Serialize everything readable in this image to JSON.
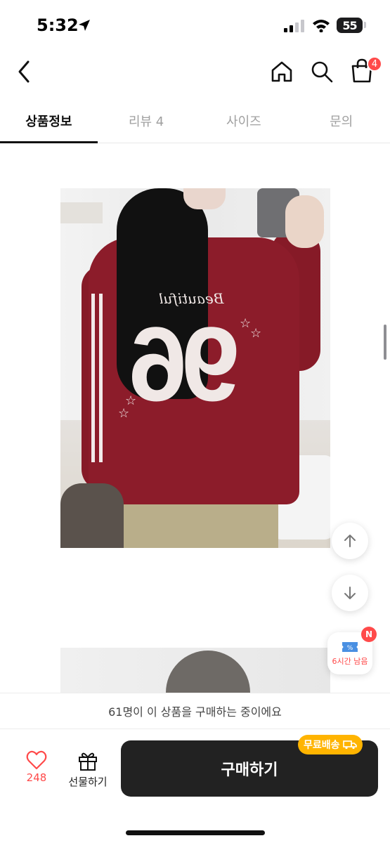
{
  "status_bar": {
    "time": "5:32",
    "battery": "55"
  },
  "header": {
    "cart_badge": "4",
    "icons": [
      "back-icon",
      "home-icon",
      "search-icon",
      "shopping-bag-icon"
    ]
  },
  "tabs": [
    {
      "label": "상품정보",
      "active": true
    },
    {
      "label": "리뷰 4",
      "active": false
    },
    {
      "label": "사이즈",
      "active": false
    },
    {
      "label": "문의",
      "active": false
    }
  ],
  "product_image": {
    "script_text": "Beautiful",
    "number": "96"
  },
  "floating": {
    "coupon_badge": "N",
    "coupon_label": "6시간 남음"
  },
  "notice": {
    "text": "61명이 이 상품을 구매하는 중이에요"
  },
  "bottom_bar": {
    "like_count": "248",
    "gift_label": "선물하기",
    "buy_label": "구매하기",
    "free_shipping_label": "무료배송"
  },
  "colors": {
    "accent_red": "#ff4a4a",
    "buy_button": "#222222",
    "free_shipping": "#ffb400"
  }
}
